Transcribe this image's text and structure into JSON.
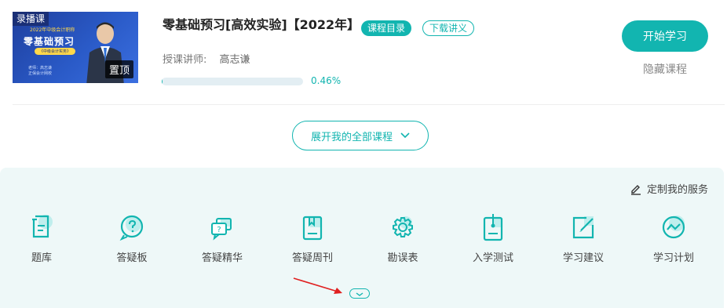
{
  "course": {
    "thumbnail": {
      "badge": "录播课",
      "subtitle": "2022年中级会计职称",
      "headline": "零基础预习",
      "pill": "《中级会计实务》",
      "teacher_line1": "老师：高志谦",
      "teacher_line2": "正保会计网校",
      "pin_label": "置顶"
    },
    "title": "零基础预习[高效实验]【2022年】",
    "tag_catalog": "课程目录",
    "tag_download": "下载讲义",
    "instructor_label": "授课讲师:",
    "instructor_name": "高志谦",
    "progress_text": "0.46%",
    "progress_fraction": 0.0046,
    "start_button": "开始学习",
    "hide_link": "隐藏课程"
  },
  "expand_button": "展开我的全部课程",
  "services": {
    "custom_label": "定制我的服务",
    "items": [
      {
        "label": "题库",
        "icon": "question-bank-icon"
      },
      {
        "label": "答疑板",
        "icon": "qa-board-icon"
      },
      {
        "label": "答疑精华",
        "icon": "qa-highlights-icon"
      },
      {
        "label": "答疑周刊",
        "icon": "qa-weekly-icon"
      },
      {
        "label": "勘误表",
        "icon": "errata-icon"
      },
      {
        "label": "入学测试",
        "icon": "entrance-test-icon"
      },
      {
        "label": "学习建议",
        "icon": "study-advice-icon"
      },
      {
        "label": "学习计划",
        "icon": "study-plan-icon"
      }
    ]
  },
  "colors": {
    "accent": "#12b5b0",
    "panel_bg": "#eef8f8",
    "annotation_arrow": "#e02020"
  }
}
